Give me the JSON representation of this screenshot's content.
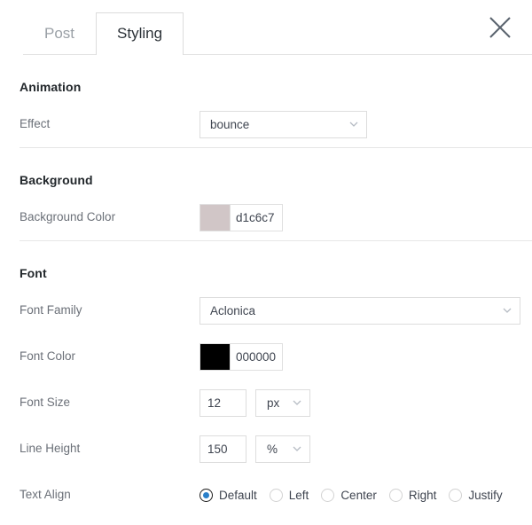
{
  "header": {
    "tabs": [
      {
        "label": "Post",
        "active": false
      },
      {
        "label": "Styling",
        "active": true
      }
    ],
    "close_label": "close-icon"
  },
  "sections": [
    {
      "title": "Animation",
      "fields": [
        {
          "label": "Effect",
          "type": "select",
          "value": "bounce"
        }
      ]
    },
    {
      "title": "Background",
      "fields": [
        {
          "label": "Background Color",
          "type": "color",
          "value": "d1c6c7",
          "swatch_hex": "#d1c6c7"
        }
      ]
    },
    {
      "title": "Font",
      "fields": [
        {
          "label": "Font Family",
          "type": "select",
          "value": "Aclonica"
        },
        {
          "label": "Font Color",
          "type": "color",
          "value": "000000",
          "swatch_hex": "#000000"
        },
        {
          "label": "Font Size",
          "type": "number-unit",
          "value": "12",
          "unit": "px"
        },
        {
          "label": "Line Height",
          "type": "number-unit",
          "value": "150",
          "unit": "%"
        },
        {
          "label": "Text Align",
          "type": "radio",
          "options": [
            {
              "label": "Default",
              "checked": true
            },
            {
              "label": "Left",
              "checked": false
            },
            {
              "label": "Center",
              "checked": false
            },
            {
              "label": "Right",
              "checked": false
            },
            {
              "label": "Justify",
              "checked": false
            }
          ]
        }
      ]
    }
  ],
  "colors": {
    "accent": "#2a7fc9",
    "border": "#e0e0e0",
    "label_text": "#6b7078",
    "heading_text": "#22272b"
  }
}
